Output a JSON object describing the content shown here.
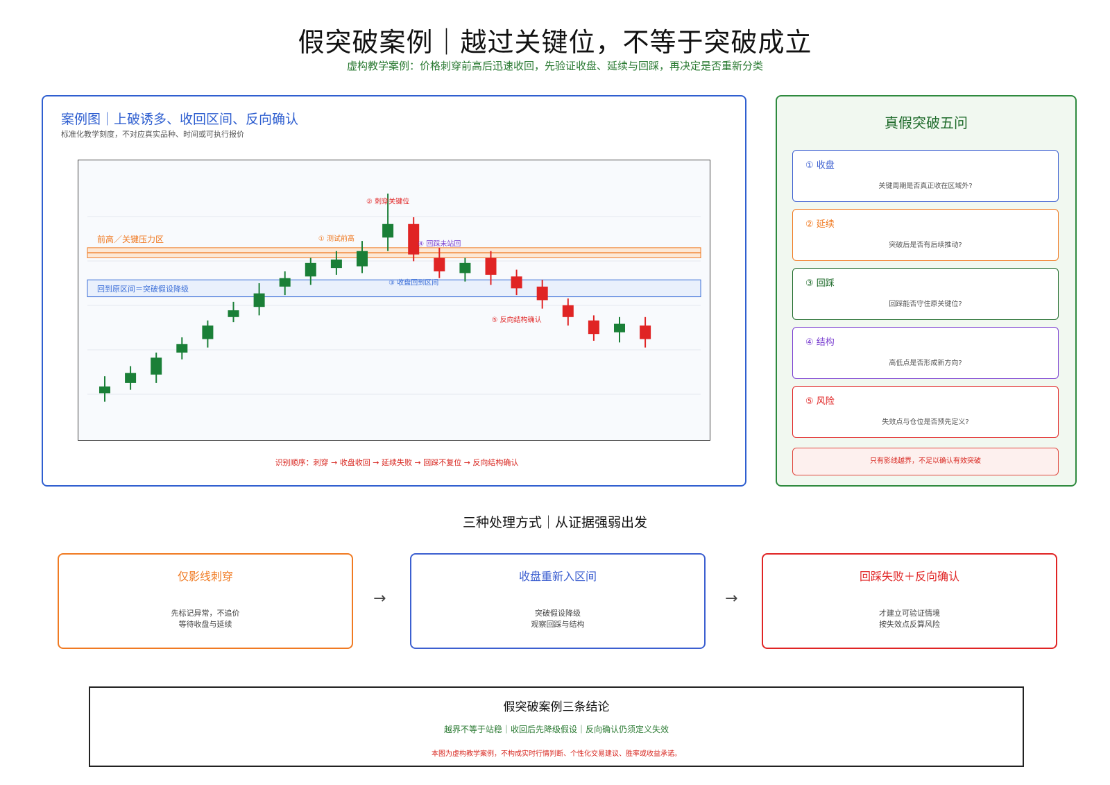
{
  "header": {
    "title": "假突破案例｜越过关键位，不等于突破成立",
    "subtitle": "虚构教学案例：价格刺穿前高后迅速收回，先验证收盘、延续与回踩，再决定是否重新分类"
  },
  "case_panel": {
    "title": "案例图｜上破诱多、收回区间、反向确认",
    "note": "标准化教学刻度，不对应真实品种、时间或可执行报价",
    "sequence": "识别顺序：刺穿 → 收盘收回 → 延续失败 → 回踩不复位 → 反向结构确认"
  },
  "chart_data": {
    "type": "candlestick",
    "up_color": "#1a7f37",
    "down_color": "#e02424",
    "zones": [
      {
        "label": "前高／关键压力区",
        "color": "#f07a22",
        "lo": 62.0,
        "hi": 65.0
      },
      {
        "label": "回到原区间＝突破假设降级",
        "color": "#3c6fd8",
        "lo": 50.5,
        "hi": 55.5
      }
    ],
    "candles": [
      {
        "o": 22.0,
        "c": 24.0,
        "h": 27.0,
        "l": 19.5
      },
      {
        "o": 25.0,
        "c": 28.0,
        "h": 30.0,
        "l": 23.0
      },
      {
        "o": 27.5,
        "c": 32.5,
        "h": 34.0,
        "l": 25.0
      },
      {
        "o": 34.0,
        "c": 36.5,
        "h": 38.5,
        "l": 32.0
      },
      {
        "o": 38.0,
        "c": 42.0,
        "h": 43.5,
        "l": 35.5
      },
      {
        "o": 44.5,
        "c": 46.5,
        "h": 49.0,
        "l": 43.0
      },
      {
        "o": 47.5,
        "c": 51.5,
        "h": 54.5,
        "l": 45.0
      },
      {
        "o": 53.5,
        "c": 56.0,
        "h": 58.0,
        "l": 51.0
      },
      {
        "o": 56.5,
        "c": 60.5,
        "h": 62.0,
        "l": 54.0
      },
      {
        "o": 59.0,
        "c": 61.5,
        "h": 64.0,
        "l": 57.0
      },
      {
        "o": 59.5,
        "c": 64.0,
        "h": 67.0,
        "l": 57.5
      },
      {
        "o": 68.0,
        "c": 72.0,
        "h": 81.0,
        "l": 64.0
      },
      {
        "o": 72.0,
        "c": 63.0,
        "h": 74.0,
        "l": 61.0
      },
      {
        "o": 62.0,
        "c": 58.0,
        "h": 65.0,
        "l": 56.0
      },
      {
        "o": 57.5,
        "c": 60.5,
        "h": 62.0,
        "l": 55.0
      },
      {
        "o": 62.0,
        "c": 57.0,
        "h": 64.0,
        "l": 54.0
      },
      {
        "o": 56.5,
        "c": 53.0,
        "h": 58.5,
        "l": 51.0
      },
      {
        "o": 53.5,
        "c": 49.5,
        "h": 55.5,
        "l": 47.0
      },
      {
        "o": 48.0,
        "c": 44.5,
        "h": 50.0,
        "l": 42.0
      },
      {
        "o": 43.5,
        "c": 39.5,
        "h": 45.0,
        "l": 37.5
      },
      {
        "o": 40.0,
        "c": 42.5,
        "h": 44.5,
        "l": 37.0
      },
      {
        "o": 42.0,
        "c": 38.0,
        "h": 44.5,
        "l": 35.5
      }
    ],
    "annotations": [
      {
        "text": "② 刺穿关键位",
        "candle": 11,
        "value": 78.0,
        "color": "#e02424"
      },
      {
        "text": "① 测试前高",
        "candle": 9,
        "value": 67.0,
        "color": "#f07a22"
      },
      {
        "text": "④ 回踩未站回",
        "candle": 13,
        "value": 65.5,
        "color": "#7a3fd0"
      },
      {
        "text": "③ 收盘回到区间",
        "candle": 12,
        "value": 54.0,
        "color": "#3c6fd8"
      },
      {
        "text": "⑤ 反向结构确认",
        "candle": 16,
        "value": 43.0,
        "color": "#e02424"
      }
    ]
  },
  "questions_panel": {
    "title": "真假突破五问",
    "items": [
      {
        "label": "① 收盘",
        "text": "关键周期是否真正收在区域外?",
        "color": "#3c5fd0"
      },
      {
        "label": "② 延续",
        "text": "突破后是否有后续推动?",
        "color": "#f07a22"
      },
      {
        "label": "③ 回踩",
        "text": "回踩能否守住原关键位?",
        "color": "#1f6b2b"
      },
      {
        "label": "④ 结构",
        "text": "高低点是否形成新方向?",
        "color": "#7a3fd0"
      },
      {
        "label": "⑤ 风险",
        "text": "失效点与仓位是否预先定义?",
        "color": "#e02424"
      }
    ],
    "warning": "只有影线越界，不足以确认有效突破"
  },
  "methods": {
    "title": "三种处理方式｜从证据强弱出发",
    "arrow": "→",
    "items": [
      {
        "title": "仅影线刺穿",
        "lines": [
          "先标记异常，不追价",
          "等待收盘与延续"
        ],
        "color": "#f07a22"
      },
      {
        "title": "收盘重新入区间",
        "lines": [
          "突破假设降级",
          "观察回踩与结构"
        ],
        "color": "#3c5fd0"
      },
      {
        "title": "回踩失败＋反向确认",
        "lines": [
          "才建立可验证情境",
          "按失效点反算风险"
        ],
        "color": "#e02424"
      }
    ]
  },
  "conclusion": {
    "title": "假突破案例三条结论",
    "points": "越界不等于站稳｜收回后先降级假设｜反向确认仍须定义失效",
    "disclaimer": "本图为虚构教学案例，不构成实时行情判断、个性化交易建议、胜率或收益承诺。"
  }
}
